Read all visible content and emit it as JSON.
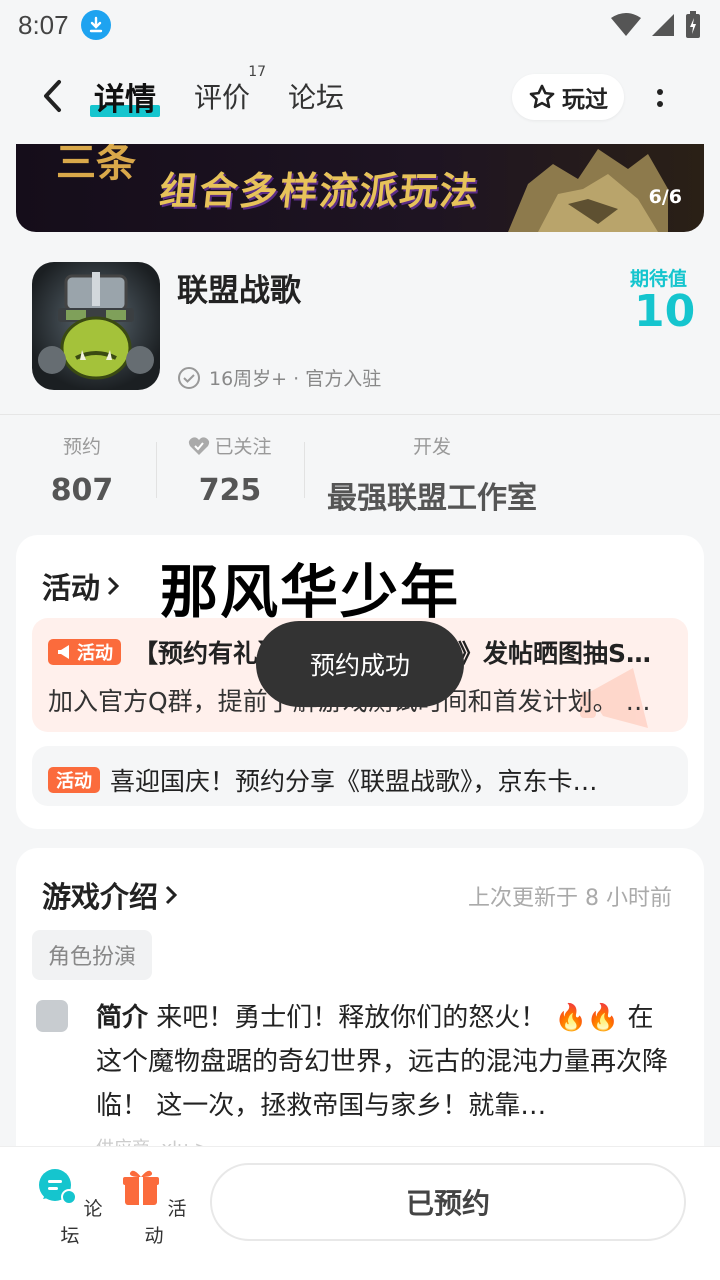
{
  "status_bar": {
    "time": "8:07"
  },
  "header": {
    "tabs": [
      {
        "label": "详情",
        "active": true
      },
      {
        "label": "评价",
        "badge": "17"
      },
      {
        "label": "论坛"
      }
    ],
    "played_label": "玩过"
  },
  "banner": {
    "text": "组合多样流派玩法",
    "deco_text": "三条",
    "page_indicator": "6/6"
  },
  "app": {
    "name": "联盟战歌",
    "meta": "16周岁+ · 官方入驻",
    "expect_label": "期待值",
    "expect_value": "10"
  },
  "stats": {
    "reserve_label": "预约",
    "reserve_value": "807",
    "follow_label": "已关注",
    "follow_value": "725",
    "dev_label": "开发",
    "dev_value": "最强联盟工作室"
  },
  "activities": {
    "title": "活动",
    "overlay_text": "那风华少年",
    "tag": "活动",
    "item1_title": "【预约有礼】转发《联盟战歌》发帖晒图抽S…",
    "item1_desc": "加入官方Q群，提前了解游戏测试时间和首发计划。 …",
    "item2_text": "喜迎国庆！预约分享《联盟战歌》，京东卡…"
  },
  "toast": "预约成功",
  "intro": {
    "title": "游戏介绍",
    "updated": "上次更新于 8 小时前",
    "genre": "角色扮演",
    "label": "简介",
    "text": "来吧！勇士们！释放你们的怒火！ 🔥🔥 在这个魔物盘踞的奇幻世界，远古的混沌力量再次降临！ 这一次，拯救帝国与家乡！就靠…",
    "footer": "供应商 ·xlu >"
  },
  "bottom": {
    "forum_label": "论坛",
    "activity_label": "活动",
    "reserved_label": "已预约"
  },
  "colors": {
    "accent": "#15c5ce",
    "activity_orange": "#fb6b3c",
    "toast_bg": "#333333"
  }
}
